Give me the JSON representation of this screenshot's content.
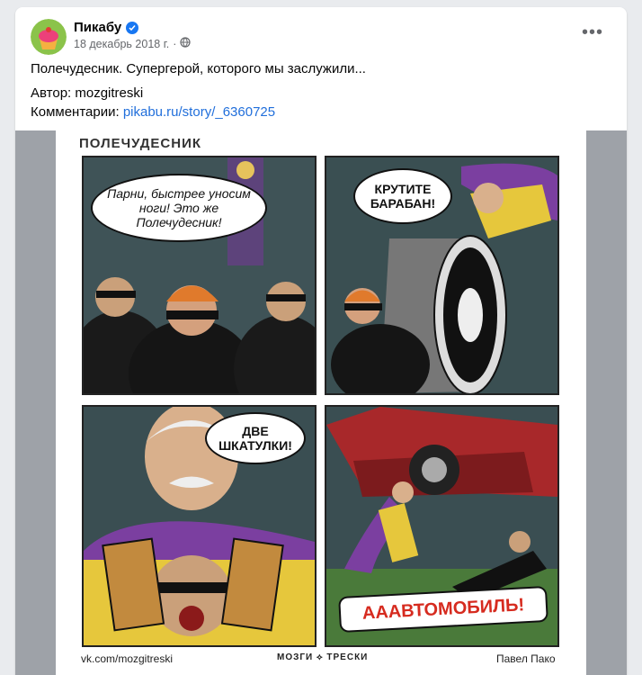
{
  "post": {
    "author": "Пикабу",
    "date": "18 декабрь 2018 г.",
    "date_sep": "·",
    "more": "•••",
    "line1": "Полечудесник. Супергерой, которого мы заслужили...",
    "author_label": "Автор: mozgitreski",
    "comments_label": "Комментарии: ",
    "comments_link": "pikabu.ru/story/_6360725"
  },
  "comic": {
    "title": "ПОЛЕЧУДЕСНИК",
    "panel1_bubble": "Парни, быстрее уносим ноги! Это же Полечудесник!",
    "panel2_bubble": "КРУТИТЕ БАРАБАН!",
    "panel3_bubble": "ДВЕ ШКАТУЛКИ!",
    "panel4_sign": "АААВТОМОБИЛЬ!",
    "footer_left": "vk.com/mozgitreski",
    "footer_center": "МОЗГИ ⟡ ТРЕСКИ",
    "footer_right": "Павел Пако"
  },
  "colors": {
    "link": "#216fdb",
    "verified": "#1877f2",
    "panel_bg": "#3f5357",
    "sign_text": "#d62b1f"
  },
  "icons": {
    "avatar": "pikabu-cupcake-logo",
    "verified": "verified-badge-icon",
    "globe": "globe-icon",
    "more": "more-options-icon"
  }
}
